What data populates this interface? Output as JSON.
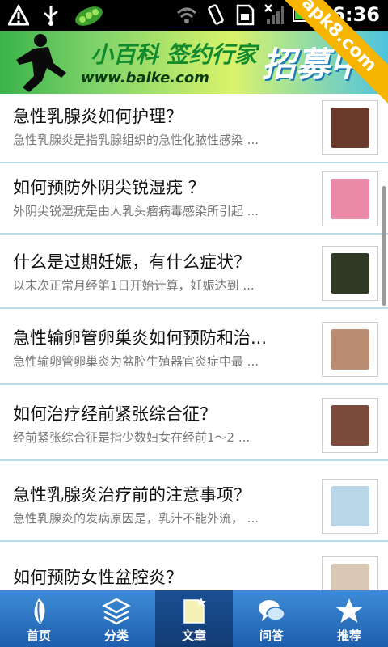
{
  "status_bar": {
    "time": "6:36",
    "icons": [
      "warning-icon",
      "usb-icon",
      "peas-icon",
      "wifi-icon",
      "vibrate-icon",
      "sim-icon",
      "no-signal-icon",
      "battery-icon"
    ]
  },
  "watermark": {
    "text": "apk8.com"
  },
  "banner": {
    "line1": "小百科 签约行家",
    "line2": "www.baike.com",
    "line3": "招募中"
  },
  "articles": [
    {
      "title": "急性乳腺炎如何护理？",
      "desc": "急性乳腺炎是指乳腺组织的急性化脓性感染 ...",
      "thumb": "#6a3a2c"
    },
    {
      "title": "如何预防外阴尖锐湿疣 ？",
      "desc": "外阴尖锐湿疣是由人乳头瘤病毒感染所引起 ...",
      "thumb": "#e98aa8"
    },
    {
      "title": "什么是过期妊娠，有什么症状？",
      "desc": "以末次正常月经第1日开始计算，妊娠达到 ...",
      "thumb": "#2e3a26"
    },
    {
      "title": "急性输卵管卵巢炎如何预防和治...",
      "desc": "急性输卵管卵巢炎为盆腔生殖器官炎症中最 ...",
      "thumb": "#b88d72"
    },
    {
      "title": "如何治疗经前紧张综合征？",
      "desc": " 经前紧张综合征是指少数妇女在经前1～2 ...",
      "thumb": "#7a4b3a"
    },
    {
      "title": "急性乳腺炎治疗前的注意事项？",
      "desc": "急性乳腺炎的发病原因是，乳汁不能外流， ...",
      "thumb": "#b9d6e8"
    },
    {
      "title": "如何预防女性盆腔炎？",
      "desc": "",
      "thumb": "#d8c7b5"
    }
  ],
  "tabs": [
    {
      "label": "首页",
      "icon": "leaf-icon",
      "active": false
    },
    {
      "label": "分类",
      "icon": "layers-icon",
      "active": false
    },
    {
      "label": "文章",
      "icon": "document-icon",
      "active": true
    },
    {
      "label": "问答",
      "icon": "chat-icon",
      "active": false
    },
    {
      "label": "推荐",
      "icon": "star-icon",
      "active": false
    }
  ]
}
